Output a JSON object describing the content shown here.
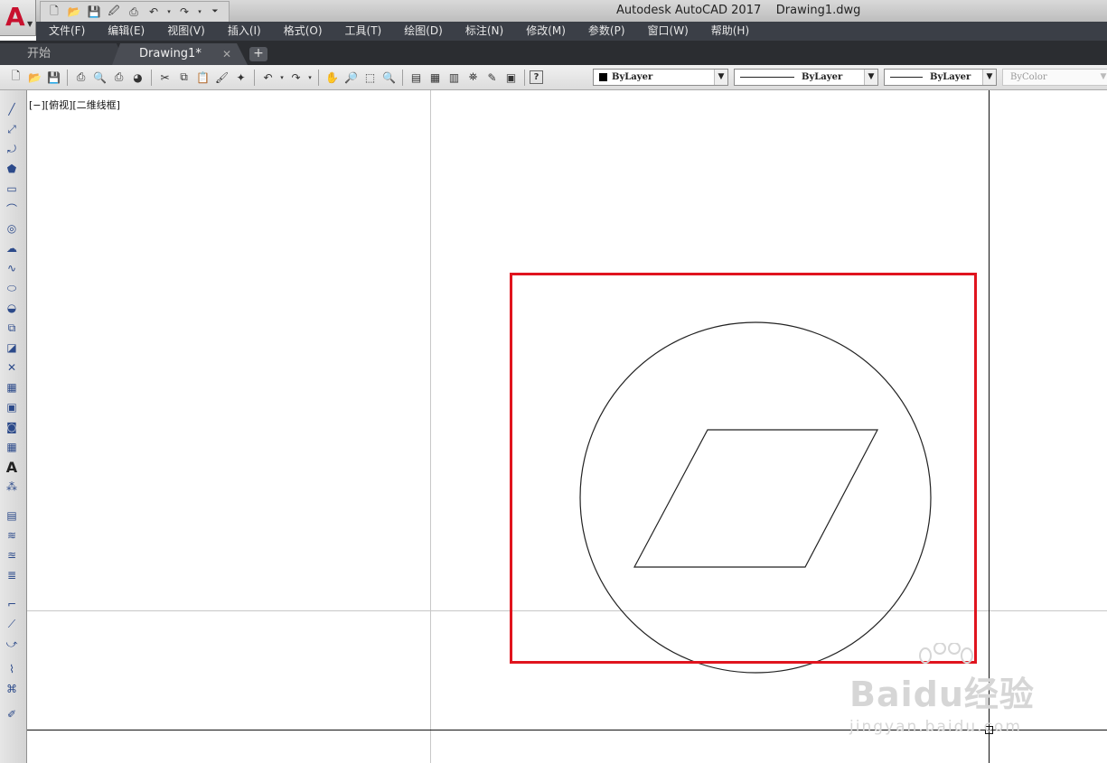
{
  "titlebar": {
    "app_title": "Autodesk AutoCAD 2017    Drawing1.dwg",
    "quick_access": [
      "new-icon",
      "open-icon",
      "save-icon",
      "saveas-icon",
      "print-icon",
      "undo-icon",
      "redo-icon",
      "customize-icon"
    ]
  },
  "app_menu": {
    "letter": "A"
  },
  "menu": {
    "items": [
      "文件(F)",
      "编辑(E)",
      "视图(V)",
      "插入(I)",
      "格式(O)",
      "工具(T)",
      "绘图(D)",
      "标注(N)",
      "修改(M)",
      "参数(P)",
      "窗口(W)",
      "帮助(H)"
    ]
  },
  "tabs": {
    "start": "开始",
    "active": "Drawing1*",
    "close": "✕",
    "add": "+"
  },
  "toolbar": {
    "layer": "ByLayer",
    "linetype": "ByLayer",
    "lineweight": "ByLayer",
    "color": "ByColor"
  },
  "viewport": {
    "label": "[−][俯视][二维线框]"
  },
  "watermark": {
    "main": "Baidu经验",
    "sub": "jingyan.baidu.com"
  },
  "colors": {
    "highlight": "#e0141e",
    "menubar": "#3b3f47",
    "tabbar": "#2b2d31"
  }
}
